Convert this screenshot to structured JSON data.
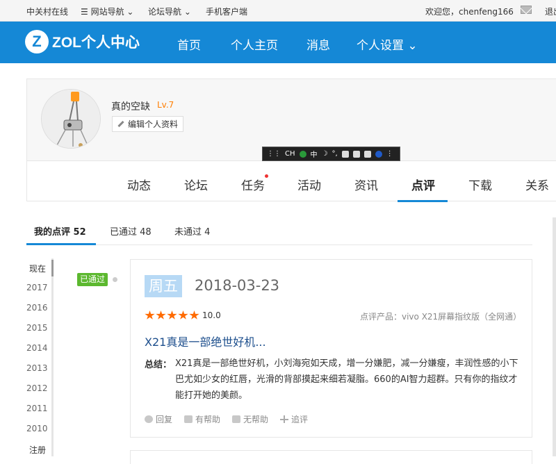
{
  "topbar": {
    "site_name": "中关村在线",
    "site_nav": "☰ 网站导航 ⌄",
    "forum_nav": "论坛导航 ⌄",
    "mobile_client": "手机客户端",
    "welcome": "欢迎您，chenfeng166",
    "logout": "退出"
  },
  "nav": {
    "logo_mark": "Z",
    "logo_text": "ZOL个人中心",
    "items": [
      "首页",
      "个人主页",
      "消息",
      "个人设置 ⌄"
    ]
  },
  "profile": {
    "username": "真的空缺",
    "level": "Lv.7",
    "edit_label": "编辑个人资料",
    "tabs": [
      "动态",
      "论坛",
      "任务",
      "活动",
      "资讯",
      "点评",
      "下载",
      "关系"
    ],
    "active_tab": "点评"
  },
  "ime_toolbar": {
    "items": [
      "CH",
      "S",
      "中",
      "☽",
      "°,",
      "⌨",
      "👕",
      "🔧",
      "?",
      "⋮"
    ]
  },
  "review_tabs": {
    "items": [
      "我的点评 52",
      "已通过 48",
      "未通过 4"
    ],
    "active": "我的点评 52"
  },
  "timeline": {
    "years": [
      "现在",
      "2017",
      "2016",
      "2015",
      "2014",
      "2013",
      "2012",
      "2011",
      "2010",
      "注册"
    ],
    "active": "现在"
  },
  "review": {
    "status": "已通过",
    "weekday": "周五",
    "date": "2018-03-23",
    "stars": 5,
    "score": "10.0",
    "product": "点评产品：vivo X21屏幕指纹版（全网通）",
    "title": "X21真是一部绝世好机...",
    "summary_label": "总结：",
    "summary": "X21真是一部绝世好机，小刘海宛如天成，增一分嫌肥，减一分嫌瘦，丰润性感的小下巴尤如少女的红唇，光滑的背部摸起来细若凝脂。660的AI智力超群。只有你的指纹才能打开她的美颜。",
    "actions": [
      "回复",
      "有帮助",
      "无帮助",
      "追评"
    ]
  },
  "colors": {
    "brand_blue": "#1588d6",
    "star_orange": "#ff6a00",
    "level_orange": "#ff7d00",
    "approved_green": "#5cb82f",
    "title_blue": "#1c4e8c"
  }
}
